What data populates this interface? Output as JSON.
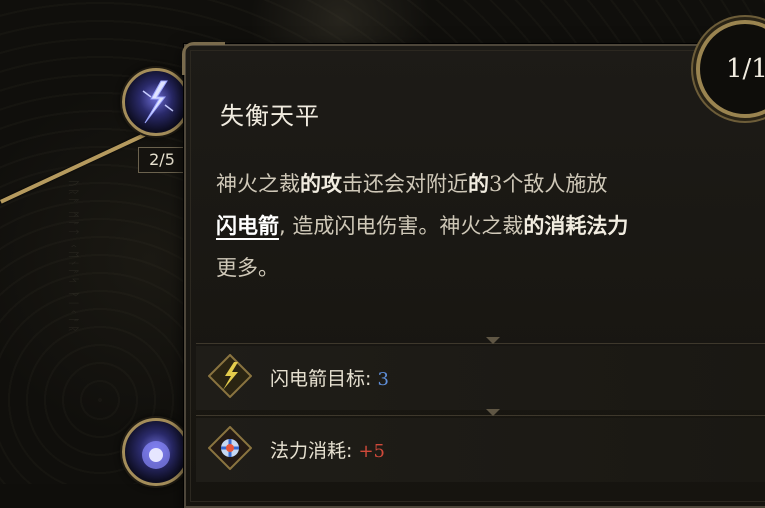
{
  "skill_tree": {
    "rune_text": "ᚢᚱᚨ ᛗᚨᛏ ᚲᛖᚾᚨᛋ ᚹᛁᚲᚨᚱ",
    "node_rank": "2/5"
  },
  "tooltip": {
    "title": "失衡天平",
    "counter": "1/1",
    "description": {
      "p1": "神火之裁",
      "p2": "的攻",
      "p3": "击还会对附近",
      "p4": "的",
      "p5": "3",
      "p6": "个敌人施放",
      "p7": "闪电箭",
      "p8": ", 造成闪电伤害。神火之裁",
      "p9": "的消耗法力",
      "p10": "更多。"
    },
    "stats": [
      {
        "label": "闪电箭目标:",
        "value": "3",
        "value_color": "#5f8fd9",
        "icon": "lightning-bolt-icon"
      },
      {
        "label": "法力消耗:",
        "value": "+5",
        "value_color": "#d04a3a",
        "icon": "mana-rune-icon"
      }
    ]
  },
  "colors": {
    "gold_frame": "#a48d5a",
    "bolt_blue": "#5f8fd9",
    "cost_red": "#d04a3a"
  }
}
